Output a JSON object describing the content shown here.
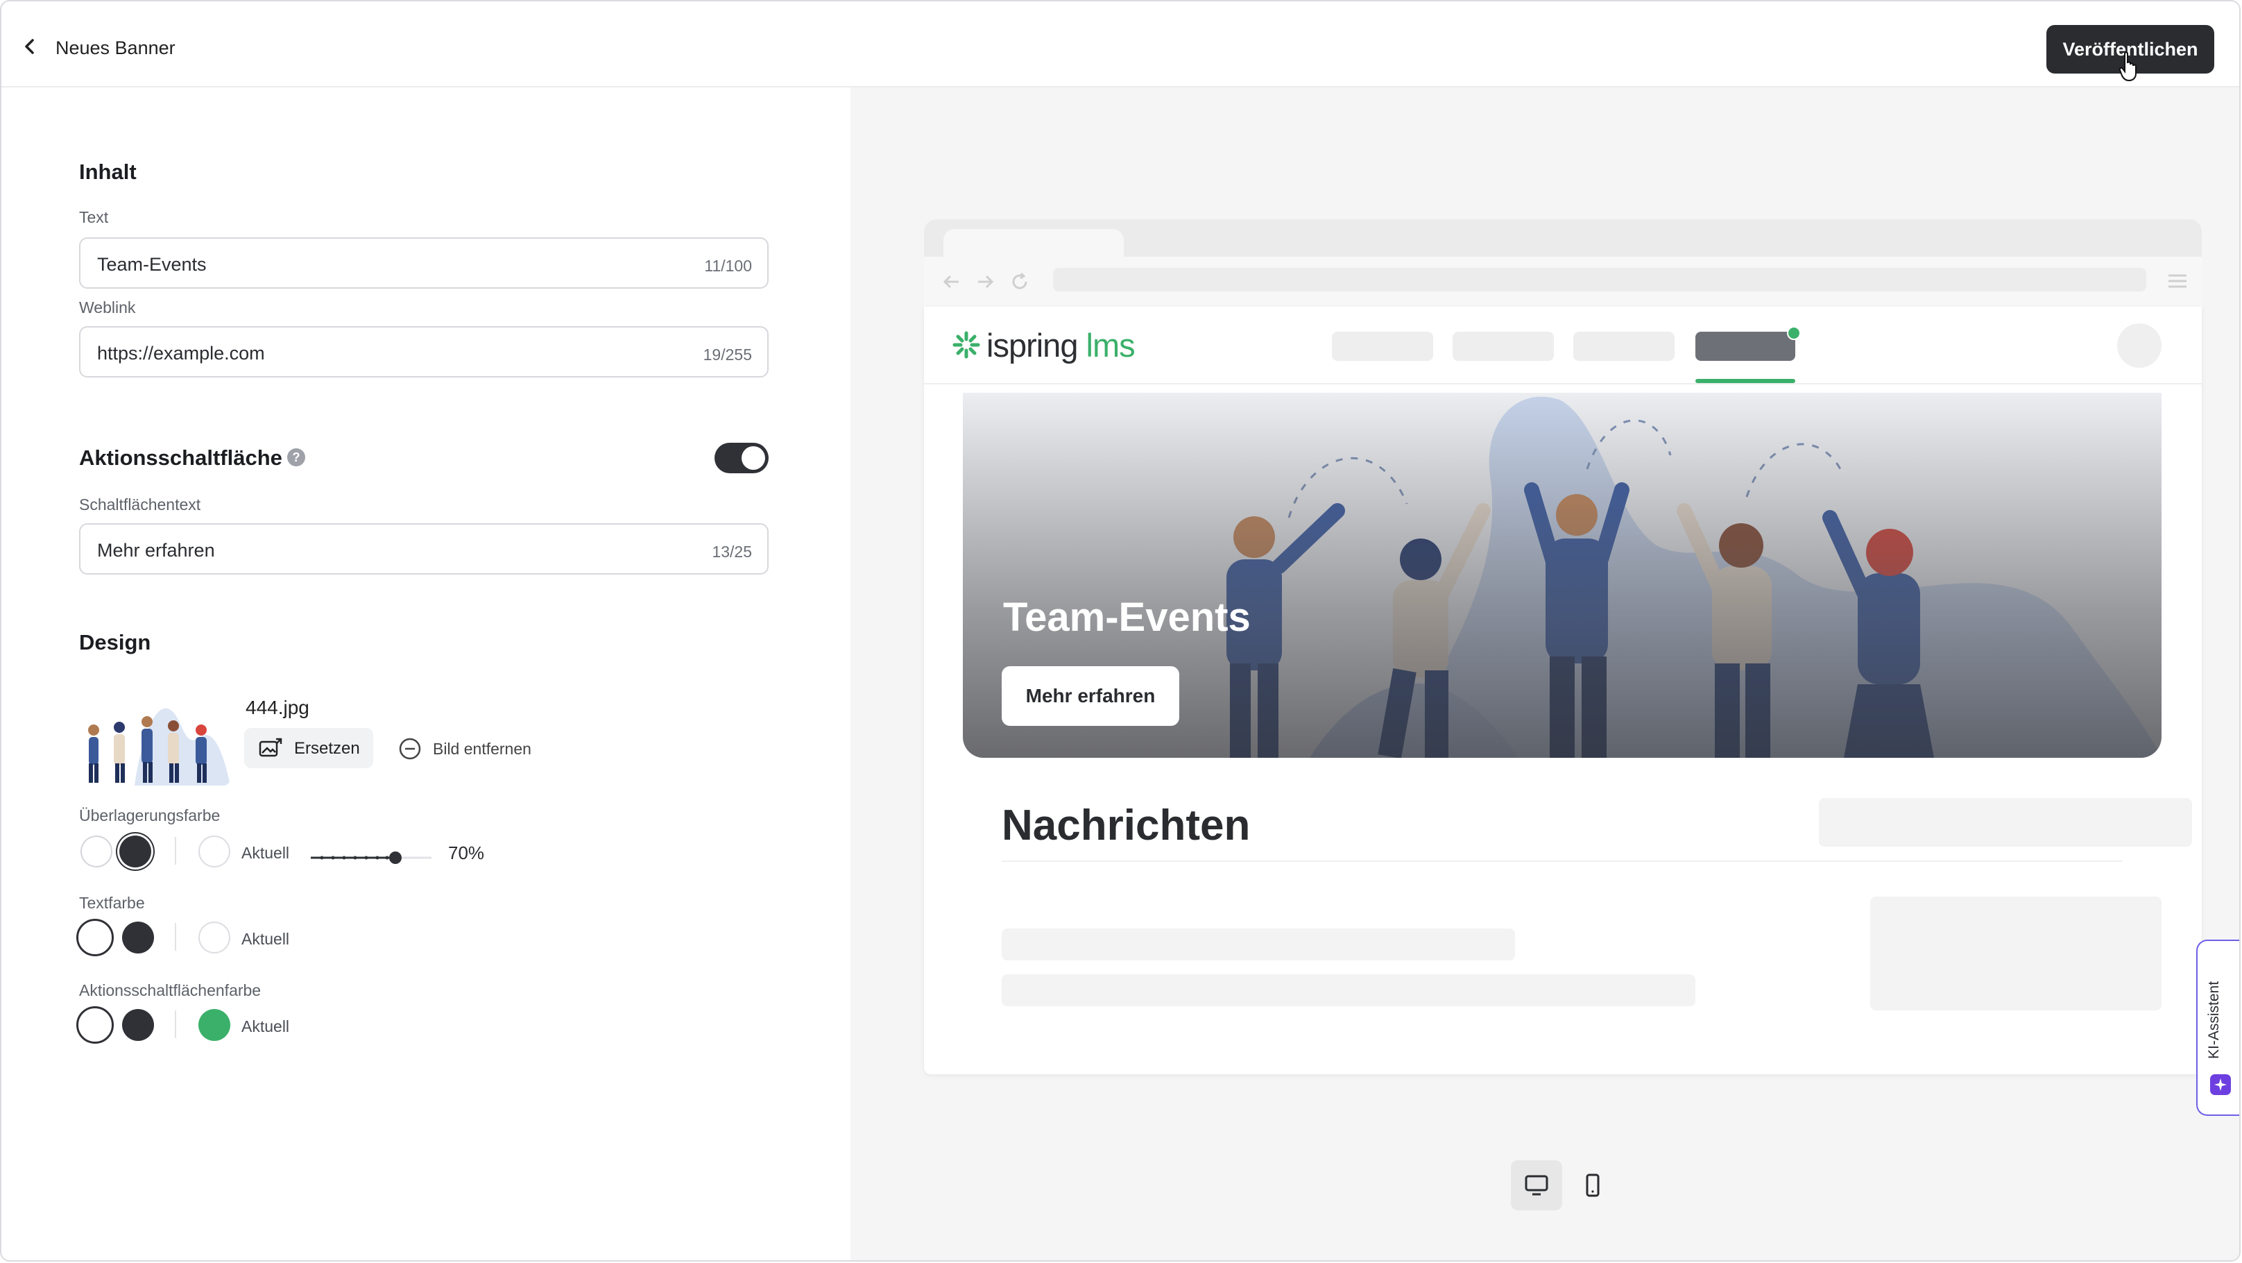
{
  "header": {
    "title": "Neues Banner",
    "publish_label": "Veröffentlichen"
  },
  "content": {
    "section_title": "Inhalt",
    "text_label": "Text",
    "text_value": "Team-Events",
    "text_counter": "11/100",
    "link_label": "Weblink",
    "link_value": "https://example.com",
    "link_counter": "19/255"
  },
  "action": {
    "section_title": "Aktionsschaltfläche",
    "help_symbol": "?",
    "toggle_on": true,
    "button_text_label": "Schaltflächentext",
    "button_text_value": "Mehr erfahren",
    "button_text_counter": "13/25"
  },
  "design": {
    "section_title": "Design",
    "file_name": "444.jpg",
    "replace_label": "Ersetzen",
    "remove_label": "Bild entfernen",
    "overlay_label": "Überlagerungsfarbe",
    "overlay_current": "Aktuell",
    "overlay_opacity": "70%",
    "overlay_opacity_fraction": 0.7,
    "textcolor_label": "Textfarbe",
    "textcolor_current": "Aktuell",
    "buttoncolor_label": "Aktionsschaltflächenfarbe",
    "buttoncolor_current": "Aktuell",
    "colors": {
      "dark": "#2f3136",
      "white": "#ffffff",
      "green": "#3bb06a"
    }
  },
  "preview": {
    "logo_main": "ispring",
    "logo_accent": "lms",
    "banner_title": "Team-Events",
    "banner_button": "Mehr erfahren",
    "news_title": "Nachrichten"
  },
  "assistant": {
    "label": "KI-Assistent"
  },
  "icons": [
    "chevron-left-icon",
    "image-replace-icon",
    "minus-circle-icon",
    "help-icon",
    "desktop-icon",
    "mobile-icon",
    "sparkle-icon",
    "back-arrow-icon",
    "forward-arrow-icon",
    "reload-icon",
    "menu-icon",
    "pointer-cursor-icon"
  ]
}
